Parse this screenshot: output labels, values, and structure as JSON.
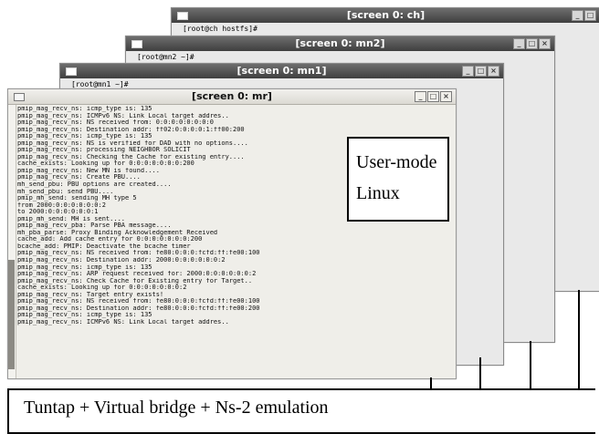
{
  "windows": [
    {
      "id": "ch",
      "title": "[screen 0: ch]",
      "prompt": "[root@ch hostfs]#"
    },
    {
      "id": "mn2",
      "title": "[screen 0: mn2]",
      "prompt": "[root@mn2 ~]#"
    },
    {
      "id": "mn1",
      "title": "[screen 0: mn1]",
      "prompt": "[root@mn1 ~]#"
    }
  ],
  "front": {
    "title": "[screen 0: mr]",
    "log": [
      "pmip_mag_recv_ns: icmp_type is: 135",
      "pmip_mag_recv_ns: ICMPv6 NS: Link Local target addres..",
      "pmip_mag_recv_ns: NS received from: 0:0:0:0:0:0:0:0",
      "pmip_mag_recv_ns: Destination addr: ff02:0:0:0:0:1:ff00:200",
      "pmip_mag_recv_ns: icmp_type is: 135",
      "pmip_mag_recv_ns: NS is verified for DAD with no options....",
      "pmip_mag_recv_ns: processing NEIGHBOR SOLICIT",
      "pmip_mag_recv_ns: Checking the Cache for existing entry....",
      "cache_exists: Looking up for 0:0:0:0:0:0:0:200",
      "pmip_mag_recv_ns: New MN is found....",
      "pmip_mag_recv_ns: Create PBU....",
      "mh_send_pbu: PBU options are created....",
      "mh_send_pbu: send PBU....",
      "pmip_mh_send: sending MH type 5",
      "from 2000:0:0:0:0:0:0:2",
      "to 2000:0:0:0:0:0:0:1",
      "pmip_mh_send: MH is sent....",
      "pmip_mag_recv_pba: Parse PBA message....",
      "mh_pba_parse: Proxy Binding Acknowledgement Received",
      "cache_add: Add cache entry for 0:0:0:0:0:0:0:200",
      "bcache_add: PMIP: Deactivate the bcache timer",
      "pmip_mag_recv_ns: NS received from: fe80:0:0:0:fcfd:ff:fe00:100",
      "pmip_mag_recv_ns: Destination addr: 2000:0:0:0:0:0:0:2",
      "pmip_mag_recv_ns: icmp_type is: 135",
      "pmip_mag_recv_ns: ARP request received for: 2000:0:0:0:0:0:0:2",
      "pmip_mag_recv_ns: Check Cache for Existing entry for Target..",
      "cache_exists: Looking up for 0:0:0:0:0:0:0:2",
      "pmip_mag_recv_ns: Target entry exists!",
      "pmip_mag_recv_ns: NS received from: fe80:0:0:0:fcfd:ff:fe00:100",
      "pmip_mag_recv_ns: Destination addr: fe80:0:0:0:fcfd:ff:fe00:200",
      "pmip_mag_recv_ns: icmp_type is: 135",
      "pmip_mag_recv_ns: ICMPv6 NS: Link Local target addres.."
    ]
  },
  "labels": {
    "user_mode_line1": "User-mode",
    "user_mode_line2": "Linux",
    "bridge": "Tuntap + Virtual bridge + Ns-2 emulation"
  },
  "controls": {
    "minimize": "_",
    "maximize": "□",
    "close": "×"
  }
}
